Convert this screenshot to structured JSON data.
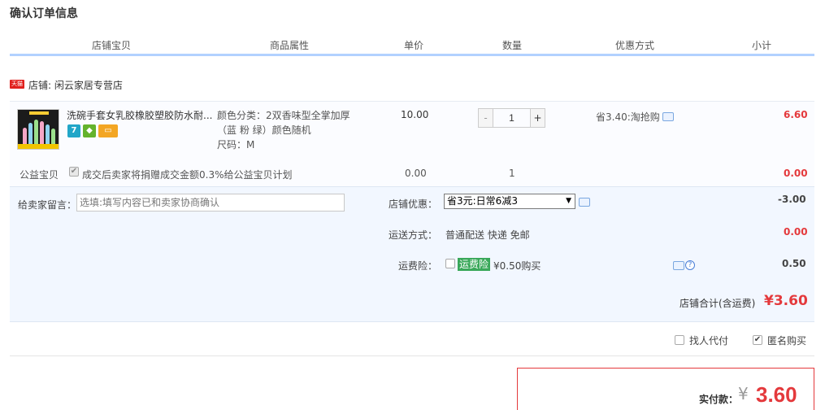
{
  "title": "确认订单信息",
  "headers": [
    "店铺宝贝",
    "商品属性",
    "单价",
    "数量",
    "优惠方式",
    "小计"
  ],
  "shop": {
    "badge": "天猫",
    "label": "店铺: 闲云家居专营店"
  },
  "item": {
    "title": "洗碗手套女乳胶橡胶塑胶防水耐...",
    "attr_line1": "颜色分类：2双香味型全掌加厚",
    "attr_line2": "（蓝 粉 绿）颜色随机",
    "attr_size": "尺码：M",
    "price": "10.00",
    "qty_minus": "-",
    "qty": "1",
    "qty_plus": "+",
    "promo": "省3.40:淘抢购",
    "subtotal": "6.60",
    "icons": [
      "7-day-return-icon",
      "shield-icon",
      "card-icon"
    ]
  },
  "charity": {
    "label": "公益宝贝",
    "text": "成交后卖家将捐赠成交金额0.3%给公益宝贝计划",
    "price": "0.00",
    "qty": "1",
    "subtotal": "0.00"
  },
  "message": {
    "label": "给卖家留言：",
    "placeholder": "选填:填写内容已和卖家协商确认"
  },
  "discount": {
    "label": "店铺优惠：",
    "selected": "省3元:日常6减3",
    "value": "-3.00"
  },
  "shipping": {
    "label": "运送方式：",
    "text": "普通配送 快递 免邮",
    "value": "0.00"
  },
  "insurance": {
    "label": "运费险：",
    "tag": "运费险",
    "text": "¥0.50购买",
    "value": "0.50"
  },
  "shop_total": {
    "label": "店铺合计(含运费)",
    "value": "¥3.60"
  },
  "options": {
    "proxy_pay": "找人代付",
    "anonymous": "匿名购买"
  },
  "pay": {
    "label": "实付款：",
    "currency": "¥",
    "value": "3.60"
  },
  "colors": {
    "accent_red": "#e4393c",
    "header_line": "#b2d1ff",
    "panel_bg": "#f2f7ff",
    "insurance_green": "#3aa85a"
  }
}
